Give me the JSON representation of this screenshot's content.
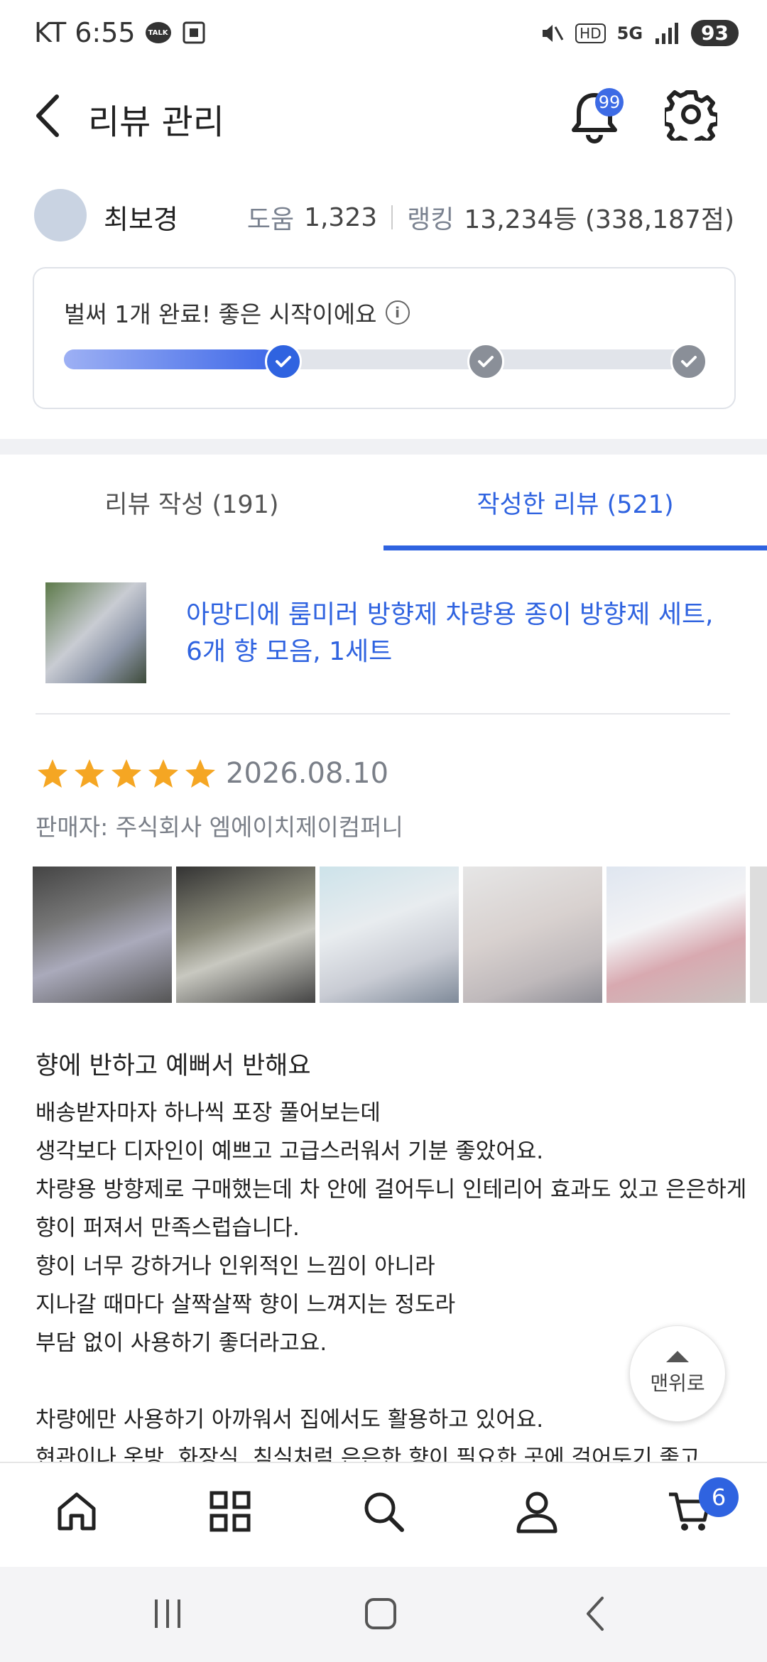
{
  "status_bar": {
    "carrier_time": "KT 6:55",
    "talk": "TALK",
    "hd": "HD",
    "net": "5G",
    "battery": "93"
  },
  "header": {
    "title": "리뷰 관리",
    "notification_count": "99"
  },
  "profile": {
    "name": "최보경",
    "help_label": "도움",
    "help_value": "1,323",
    "ranking_label": "랭킹",
    "ranking_value": "13,234등 (338,187점)"
  },
  "progress": {
    "message": "벌써 1개 완료! 좋은 시작이에요",
    "info_icon": "i",
    "completed_fraction": 0.33,
    "steps": 3,
    "steps_done": 1
  },
  "tabs": [
    {
      "label": "리뷰 작성 (191)",
      "active": false
    },
    {
      "label": "작성한 리뷰 (521)",
      "active": true
    }
  ],
  "product": {
    "title": "아망디에 룸미러 방향제 차량용 종이 방향제 세트, 6개 향 모음, 1세트"
  },
  "review": {
    "rating": 5,
    "date": "2026.08.10",
    "seller": "판매자: 주식회사 엠에이치제이컴퍼니",
    "title": "향에 반하고 예뻐서 반해요",
    "lines": [
      "배송받자마자 하나씩 포장 풀어보는데",
      "생각보다 디자인이 예쁘고 고급스러워서 기분 좋았어요.",
      "차량용 방향제로 구매했는데 차 안에 걸어두니 인테리어 효과도 있고 은은하게",
      "향이 퍼져서 만족스럽습니다.",
      "향이 너무 강하거나 인위적인 느낌이 아니라",
      "지나갈 때마다 살짝살짝 향이 느껴지는 정도라",
      "부담 없이 사용하기 좋더라고요.",
      "",
      "차량에만 사용하기 아까워서 집에서도 활용하고 있어요.",
      "현관이나 옷방, 화장실, 침실처럼 은은한 향이 필요한 곳에 걸어두기 좋고"
    ]
  },
  "top_button": {
    "label": "맨위로"
  },
  "bottom_nav": {
    "cart_count": "6"
  },
  "colors": {
    "accent": "#2f63e0",
    "star": "#f5a623"
  }
}
